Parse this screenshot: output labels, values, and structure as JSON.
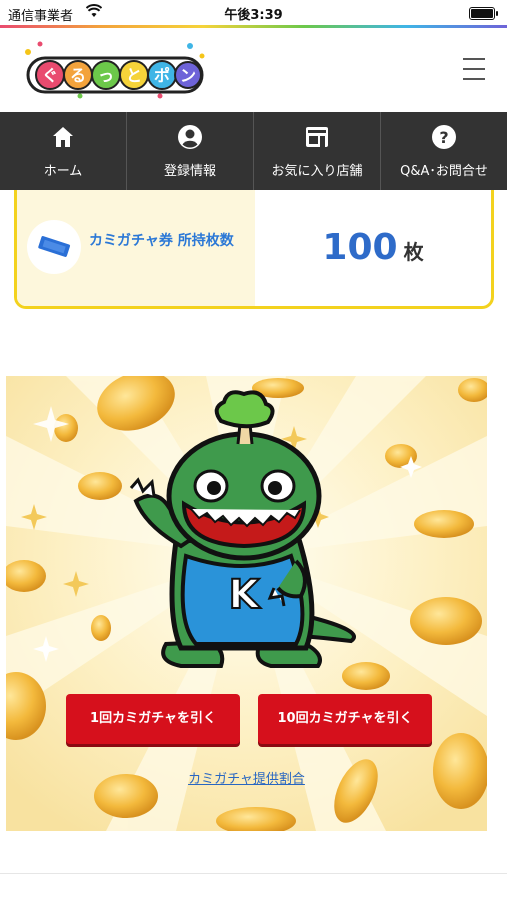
{
  "status_bar": {
    "carrier": "通信事業者",
    "time": "午後3:39"
  },
  "header": {
    "logo_text": "ぐるっとポン",
    "menu_icon": "hamburger-menu-icon"
  },
  "nav": {
    "items": [
      {
        "label": "ホーム",
        "icon": "home-icon"
      },
      {
        "label": "登録情報",
        "icon": "user-icon"
      },
      {
        "label": "お気に入り店舗",
        "icon": "shop-icon"
      },
      {
        "label": "Q&A･お問合せ",
        "icon": "help-icon"
      }
    ]
  },
  "ticket": {
    "label": "カミガチャ券 所持枚数",
    "count": "100",
    "unit": "枚",
    "icon": "ticket-icon"
  },
  "gacha": {
    "mascot_letter": "K",
    "button_1": "1回カミガチャを引く",
    "button_10": "10回カミガチャを引く",
    "rate_link": "カミガチャ提供割合"
  },
  "colors": {
    "accent_red": "#d6101c",
    "nav_bg": "#333333",
    "ticket_border": "#f3d21e",
    "link_blue": "#2866c2"
  }
}
